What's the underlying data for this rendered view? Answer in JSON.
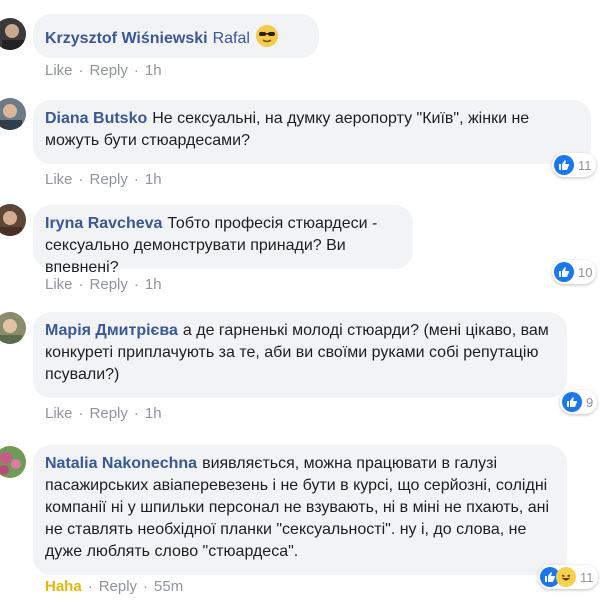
{
  "comments": [
    {
      "author": "Krzysztof Wiśniewski",
      "text": "Rafal",
      "emoji": "cool-sunglasses-emoji",
      "actions": {
        "reaction": "Like",
        "reply": "Reply",
        "time": "1h"
      },
      "count": ""
    },
    {
      "author": "Diana Butsko",
      "text": "Не сексуальні, на думку аеропорту \"Київ\", жінки не можуть бути стюардесами?",
      "actions": {
        "reaction": "Like",
        "reply": "Reply",
        "time": "1h"
      },
      "count": "11"
    },
    {
      "author": "Iryna Ravcheva",
      "text": "Тобто професія стюардеси - сексуально демонструвати принади? Ви впевнені?",
      "actions": {
        "reaction": "Like",
        "reply": "Reply",
        "time": "1h"
      },
      "count": "10"
    },
    {
      "author": "Марія Дмитрієва",
      "text": "а де гарненькі молоді стюарди? (мені цікаво, вам конкуреті приплачують за те, аби ви своїми руками собі репутацію псували?)",
      "actions": {
        "reaction": "Like",
        "reply": "Reply",
        "time": "1h"
      },
      "count": "9"
    },
    {
      "author": "Natalia Nakonechna",
      "text": "виявляється, можна працювати в галузі пасажирських авіаперевезень і не бути в курсі, що серйозні, солідні компанії ні у шпильки персонал не взувають, ні в міні не пхають, ані не ставлять необхідної планки \"сексуальності\". ну і, до слова, не дуже люблять слово \"стюардеса\".",
      "actions": {
        "reaction": "Haha",
        "reply": "Reply",
        "time": "55m"
      },
      "count": "11"
    }
  ],
  "colors": {
    "author": "#385898",
    "bubble": "#f2f3f5",
    "action": "#90949c",
    "like": "#1877f2",
    "haha": "#e6b800"
  }
}
